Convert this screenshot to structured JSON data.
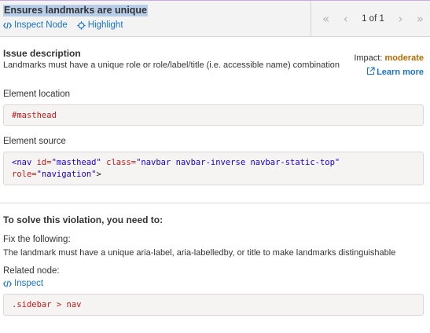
{
  "header": {
    "rule_title": "Ensures landmarks are unique",
    "inspect_node_label": "Inspect Node",
    "highlight_label": "Highlight",
    "pager": {
      "count": "1 of 1"
    }
  },
  "issue": {
    "title": "Issue description",
    "description": "Landmarks must have a unique role or role/label/title (i.e. accessible name) combination",
    "impact_label": "Impact:",
    "impact_value": "moderate",
    "learn_more_label": "Learn more"
  },
  "element_location": {
    "label": "Element location",
    "selector": "#masthead"
  },
  "element_source": {
    "label": "Element source",
    "line1_open": "<nav ",
    "attr_id": "id=",
    "val_id": "\"masthead\"",
    "attr_class": "class=",
    "val_class": "\"navbar navbar-inverse navbar-static-top\"",
    "attr_role": "role=",
    "val_role": "\"navigation\"",
    "close": ">"
  },
  "solve": {
    "title": "To solve this violation, you need to:",
    "fix_label": "Fix the following:",
    "fix_text": "The landmark must have a unique aria-label, aria-labelledby, or title to make landmarks distinguishable",
    "related_label": "Related node:",
    "inspect_label": "Inspect",
    "related_selector": ".sidebar > nav"
  },
  "colors": {
    "link": "#1a73c8",
    "impact_moderate": "#b36b00",
    "title_highlight": "#b8cde8"
  }
}
